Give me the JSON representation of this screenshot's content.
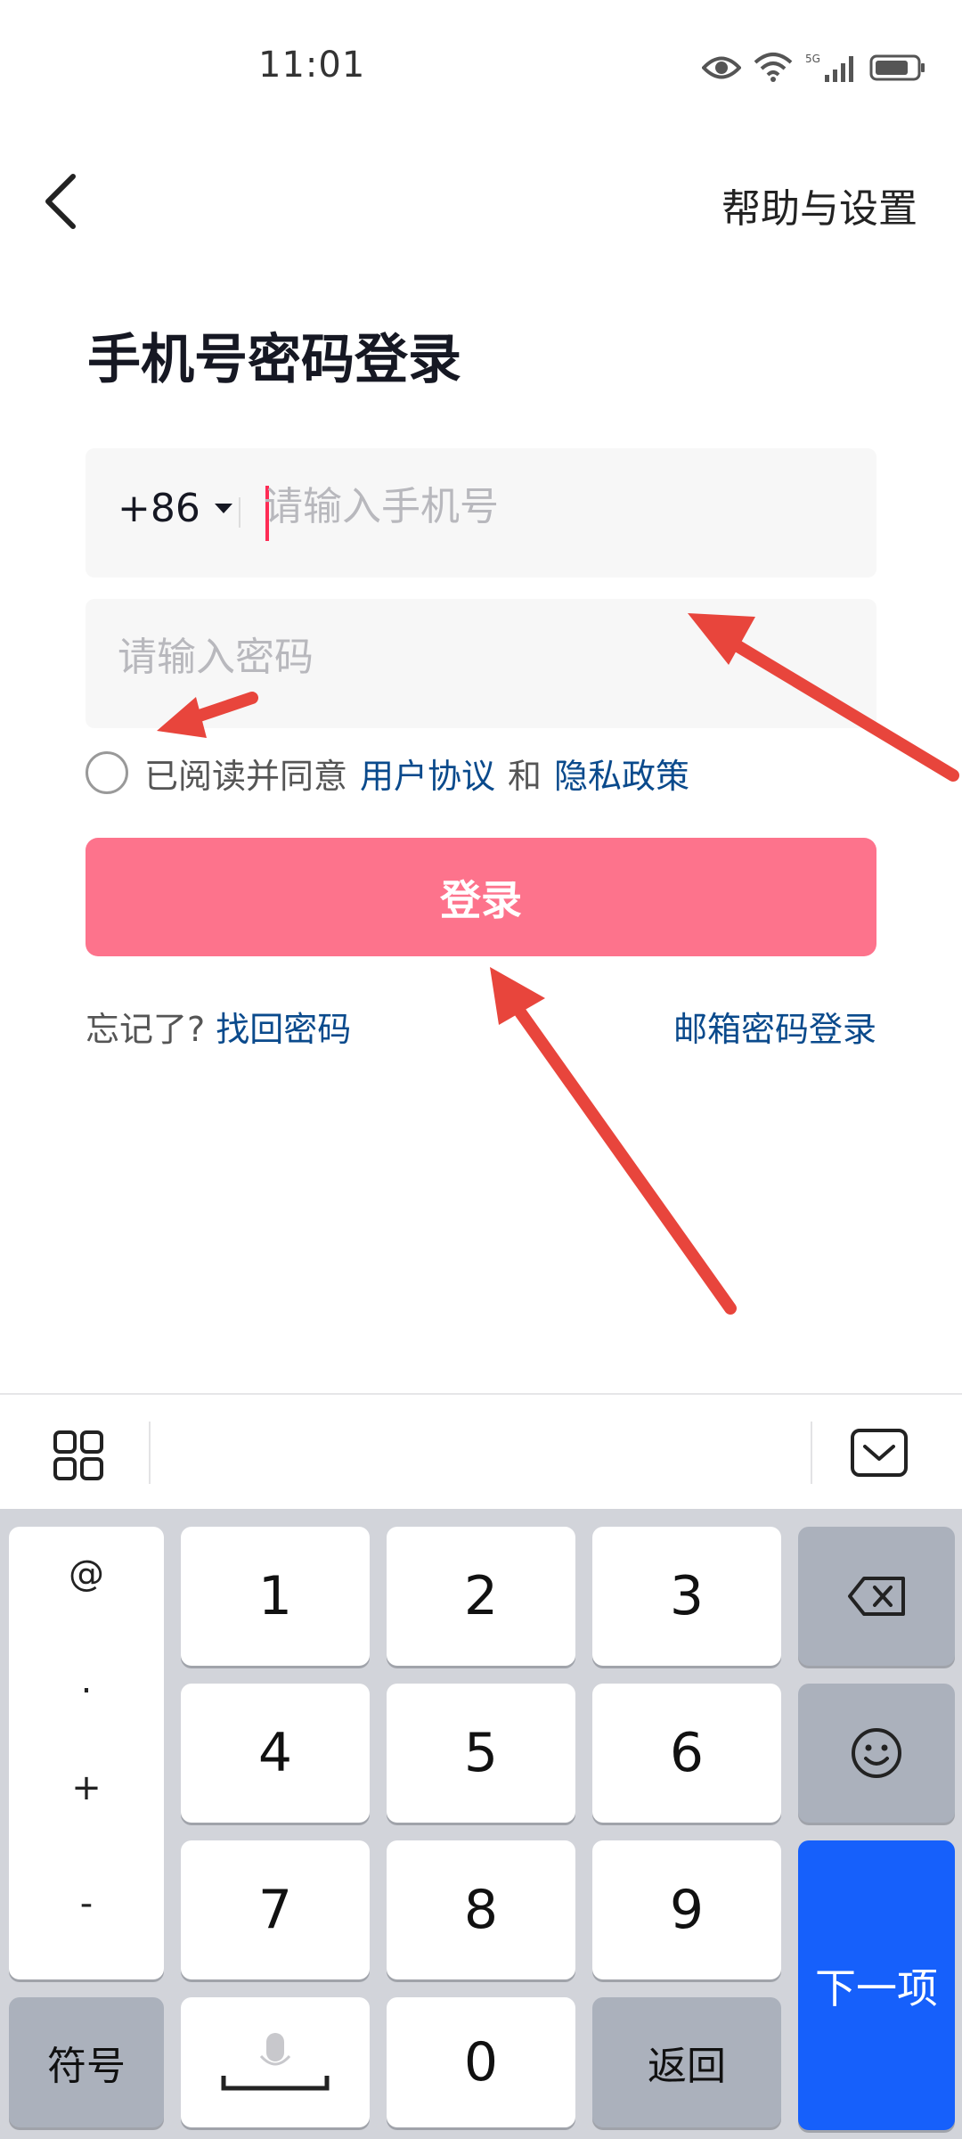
{
  "status_bar": {
    "time": "11:01",
    "network": "5G"
  },
  "nav": {
    "help_label": "帮助与设置"
  },
  "title": "手机号密码登录",
  "phone": {
    "country_code": "+86",
    "placeholder": "请输入手机号"
  },
  "password": {
    "placeholder": "请输入密码"
  },
  "agreement": {
    "prefix": "已阅读并同意",
    "user_agreement": "用户协议",
    "and": "和",
    "privacy_policy": "隐私政策"
  },
  "login_button": "登录",
  "forgot": {
    "prefix": "忘记了?",
    "link": "找回密码"
  },
  "email_login": "邮箱密码登录",
  "colors": {
    "primary": "#fd738c",
    "link": "#0a4a8c",
    "cursor": "#fe2c55",
    "annotation": "#e8453c",
    "keyboard_next": "#1660fb"
  },
  "keyboard": {
    "symbols": [
      "@",
      ".",
      "+",
      "-"
    ],
    "digits": [
      "1",
      "2",
      "3",
      "4",
      "5",
      "6",
      "7",
      "8",
      "9",
      "0"
    ],
    "symbol_key": "符号",
    "back_key": "返回",
    "next_key": "下一项"
  }
}
